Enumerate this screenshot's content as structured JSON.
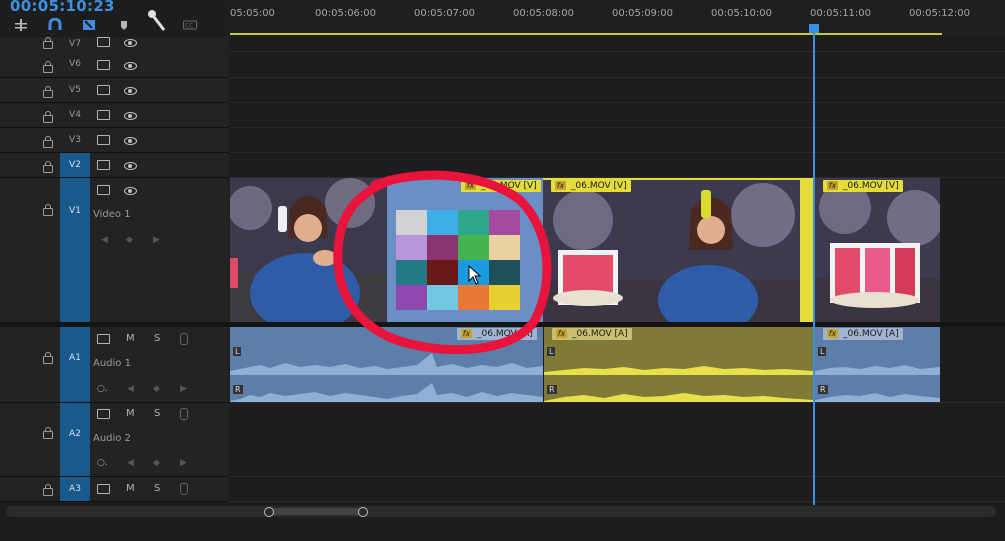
{
  "timecode": "00:05:10:23",
  "ruler": {
    "labels": [
      "05:05:00",
      "00:05:06:00",
      "00:05:07:00",
      "00:05:08:00",
      "00:05:09:00",
      "00:05:10:00",
      "00:05:11:00",
      "00:05:12:00"
    ]
  },
  "tracks": {
    "v7": "V7",
    "v6": "V6",
    "v5": "V5",
    "v4": "V4",
    "v3": "V3",
    "v2": "V2",
    "v1": "V1",
    "video1_label": "Video 1",
    "a1": "A1",
    "audio1_label": "Audio 1",
    "a2": "A2",
    "audio2_label": "Audio 2",
    "a3": "A3",
    "mute_label": "M",
    "solo_label": "S"
  },
  "clips": {
    "v_clip2": "_06.MOV [V]",
    "v_clip3": "_06.MOV [V]",
    "v_clip4": "_06.MOV [V]",
    "a_clip2": "_06.MOV [A]",
    "a_clip3": "_06.MOV [A]",
    "a_clip4": "_06.MOV [A]",
    "fx": "fx",
    "left_channel": "L",
    "right_channel": "R"
  },
  "colors": {
    "accent": "#3f8fde",
    "playhead": "#3a8ee6",
    "annotation": "#e8143c",
    "selected_clip": "#e8e03a",
    "audio_clip": "#5d7ea8"
  },
  "icons": [
    "ripple-edit-icon",
    "snap-magnet-icon",
    "linked-selection-icon",
    "marker-icon",
    "wrench-icon",
    "captions-icon"
  ]
}
